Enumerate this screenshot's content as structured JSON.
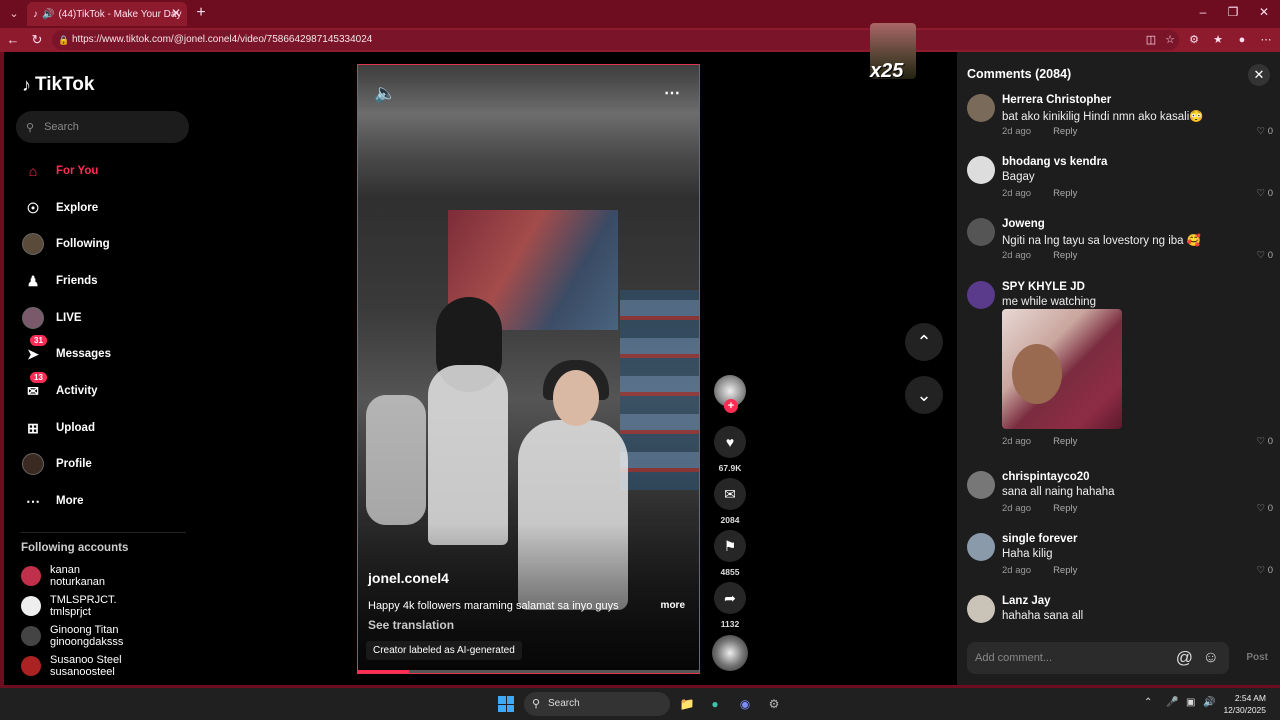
{
  "browser": {
    "tab_title": "(44)TikTok - Make Your Day",
    "url": "https://www.tiktok.com/@jonel.conel4/video/7586642987145334024"
  },
  "sidebar": {
    "logo": "TikTok",
    "search_placeholder": "Search",
    "nav": [
      {
        "label": "For You",
        "icon": "home-icon"
      },
      {
        "label": "Explore",
        "icon": "compass-icon"
      },
      {
        "label": "Following",
        "icon": "avatar"
      },
      {
        "label": "Friends",
        "icon": "friends-icon"
      },
      {
        "label": "LIVE",
        "icon": "avatar"
      },
      {
        "label": "Messages",
        "icon": "send-icon",
        "badge": "31"
      },
      {
        "label": "Activity",
        "icon": "inbox-icon",
        "badge": "13"
      },
      {
        "label": "Upload",
        "icon": "plus-square-icon"
      },
      {
        "label": "Profile",
        "icon": "avatar"
      },
      {
        "label": "More",
        "icon": "ellipsis-icon"
      }
    ],
    "following_title": "Following accounts",
    "following": [
      {
        "name": "kanan",
        "handle": "noturkanan"
      },
      {
        "name": "TMLSPRJCT.",
        "handle": "tmlsprjct"
      },
      {
        "name": "Ginoong Titan",
        "handle": "ginoongdaksss"
      },
      {
        "name": "Susanoo Steel",
        "handle": "susanoosteel"
      }
    ]
  },
  "video": {
    "author": "jonel.conel4",
    "caption": "Happy 4k followers maraming salamat sa inyo guys",
    "caption_more": "more",
    "see_translation": "See translation",
    "ai_label": "Creator labeled as AI-generated",
    "progress": 0.15,
    "likes": "67.9K",
    "comments": "2084",
    "saves": "4855",
    "shares": "1132"
  },
  "overlay": {
    "sticker_text": "x25"
  },
  "comments_panel": {
    "title": "Comments (2084)",
    "input_placeholder": "Add comment...",
    "post_label": "Post",
    "items": [
      {
        "user": "Herrera Christopher",
        "text": "bat ako kinikilig Hindi nmn ako kasali😳",
        "time": "2d ago",
        "reply": "Reply",
        "likes": "0"
      },
      {
        "user": "bhodang vs kendra",
        "text": "Bagay",
        "time": "2d ago",
        "reply": "Reply",
        "likes": "0"
      },
      {
        "user": "Joweng",
        "text": "Ngiti na lng tayu sa lovestory ng iba 🥰",
        "time": "2d ago",
        "reply": "Reply",
        "likes": "0"
      },
      {
        "user": "SPY KHYLE JD",
        "text": "me while watching",
        "time": "2d ago",
        "reply": "Reply",
        "likes": "0"
      },
      {
        "user": "chrispintayco20",
        "text": "sana all naing hahaha",
        "time": "2d ago",
        "reply": "Reply",
        "likes": "0"
      },
      {
        "user": "single forever",
        "text": "Haha kilig",
        "time": "2d ago",
        "reply": "Reply",
        "likes": "0"
      },
      {
        "user": "Lanz Jay",
        "text": "hahaha sana all",
        "time": "",
        "reply": "",
        "likes": ""
      }
    ]
  },
  "taskbar": {
    "search": "Search",
    "time": "2:54 AM",
    "date": "12/30/2025"
  }
}
